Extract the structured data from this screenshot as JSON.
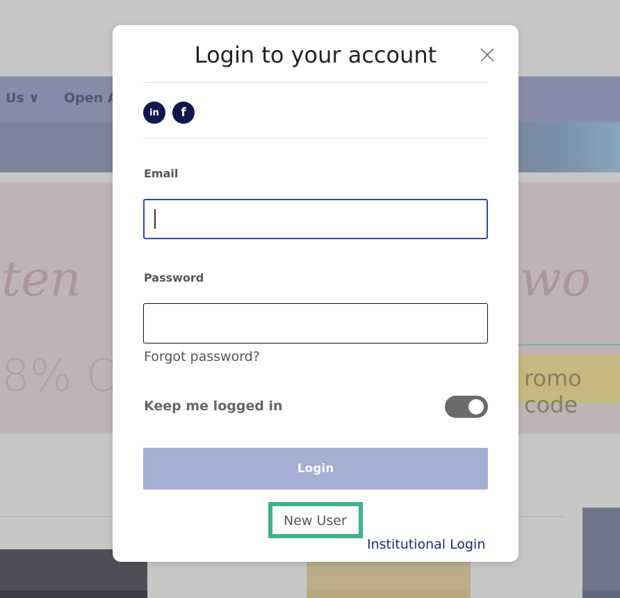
{
  "background": {
    "nav_item_1": "Us ∨",
    "nav_item_2": "Open A",
    "script_left": "ten",
    "script_right": "wo",
    "percent_text": "8% O",
    "promo_code_text": "romo code"
  },
  "modal": {
    "title": "Login to your account",
    "social": [
      {
        "icon": "linkedin-icon",
        "label": "in"
      },
      {
        "icon": "facebook-icon",
        "label": "f"
      }
    ],
    "email_label": "Email",
    "email_value": "",
    "password_label": "Password",
    "password_value": "",
    "forgot_password": "Forgot password?",
    "keep_logged_in": "Keep me logged in",
    "keep_logged_in_enabled": true,
    "login_button": "Login",
    "new_user": "New User",
    "institutional_login": "Institutional Login"
  },
  "colors": {
    "highlight": "#3bb486",
    "login_button": "#a4aed2",
    "social_bg": "#10174d",
    "link": "#1c2a78"
  }
}
